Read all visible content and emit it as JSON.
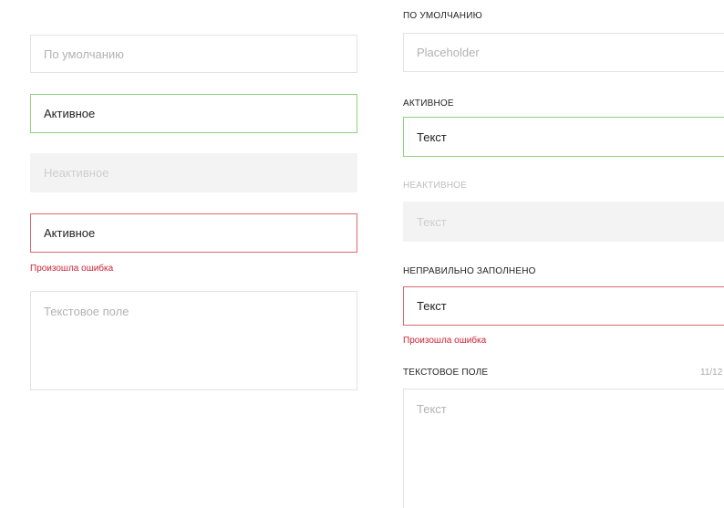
{
  "left_column": {
    "default_field": {
      "placeholder": "По умолчанию"
    },
    "active_field": {
      "value": "Активное"
    },
    "disabled_field": {
      "placeholder": "Неактивное"
    },
    "error_field": {
      "value": "Активное",
      "error_message": "Произошла ошибка"
    },
    "textarea_field": {
      "placeholder": "Текстовое поле"
    }
  },
  "right_column": {
    "default_field": {
      "label": "ПО УМОЛЧАНИЮ",
      "placeholder": "Placeholder"
    },
    "active_field": {
      "label": "АКТИВНОЕ",
      "value": "Текст"
    },
    "disabled_field": {
      "label": "НЕАКТИВНОЕ",
      "placeholder": "Текст"
    },
    "error_field": {
      "label": "НЕПРАВИЛЬНО ЗАПОЛНЕНО",
      "value": "Текст",
      "error_message": "Произошла ошибка"
    },
    "textarea_field": {
      "label": "ТЕКСТОВОЕ ПОЛЕ",
      "counter": "11/12",
      "placeholder": "Текст"
    }
  },
  "colors": {
    "active_border": "#8fd17f",
    "error_border": "#d86a72",
    "error_text": "#cc2233",
    "disabled_background": "#f3f3f3",
    "default_border": "#e3e3e3"
  }
}
